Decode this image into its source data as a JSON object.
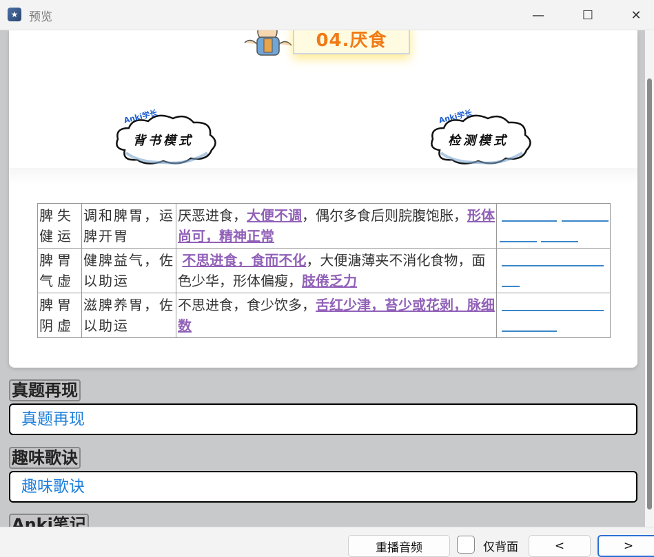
{
  "window": {
    "title": "预览",
    "minimize_glyph": "—",
    "maximize_glyph": "☐",
    "close_glyph": "✕"
  },
  "banner": {
    "topic": "04.厌食"
  },
  "modes": {
    "left": {
      "brand": "Anki学长",
      "label": "背书模式"
    },
    "right": {
      "brand": "Anki学长",
      "label": "检测模式"
    }
  },
  "table": {
    "rows": [
      {
        "syndrome": "脾失健运",
        "treatment": "调和脾胃，运脾开胃",
        "sym_1": "厌恶进食，",
        "sym_hl_1": "大便不调",
        "sym_2": "，偶尔多食后则脘腹饱胀，",
        "sym_hl_2": "形体尚可，精神正常",
        "sym_3": ""
      },
      {
        "syndrome": "脾胃气虚",
        "treatment": "健脾益气，佐以助运",
        "sym_1": "",
        "sym_hl_1": "不思进食，食而不化",
        "sym_2": "，大便溏薄夹不消化食物，面色少华，形体偏瘦，",
        "sym_hl_2": "肢倦乏力",
        "sym_3": ""
      },
      {
        "syndrome": "脾胃阴虚",
        "treatment": "滋脾养胃，佐以助运",
        "sym_1": "不思进食，食少饮多，",
        "sym_hl_1": "舌红少津，苔少或花剥，脉细数",
        "sym_2": "",
        "sym_hl_2": "",
        "sym_3": ""
      }
    ]
  },
  "sections": {
    "zhenti_head": "真题再现",
    "zhenti_body": "真题再现",
    "gejue_head": "趣味歌诀",
    "gejue_body": "趣味歌诀",
    "notes_head": "Anki笔记"
  },
  "bottom": {
    "replay": "重播音频",
    "back_only": "仅背面",
    "prev": "<",
    "next": ">"
  },
  "colors": {
    "topic": "#f07b16",
    "highlight": "#9161b8",
    "link_blue": "#1d7fdb",
    "blank_line": "#3a86c8"
  }
}
